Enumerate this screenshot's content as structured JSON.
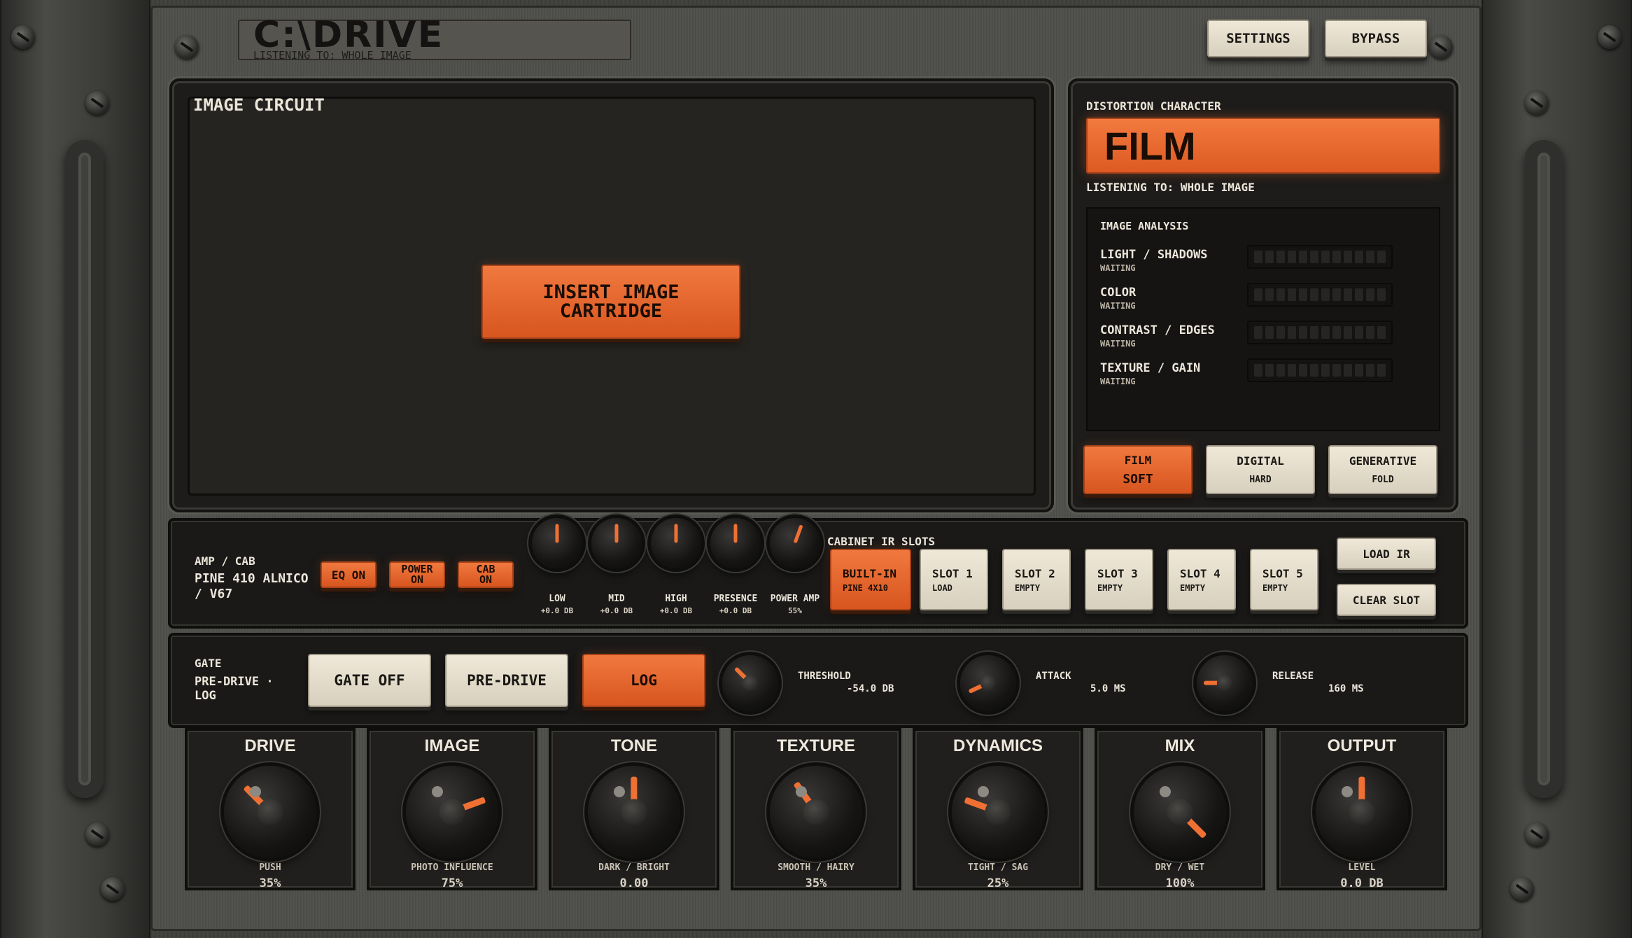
{
  "header": {
    "logo": "C:\\DRIVE",
    "listening": "LISTENING TO: WHOLE IMAGE",
    "settings_label": "SETTINGS",
    "bypass_label": "BYPASS"
  },
  "image_circuit": {
    "title": "IMAGE CIRCUIT",
    "insert_label_1": "INSERT IMAGE",
    "insert_label_2": "CARTRIDGE"
  },
  "distortion": {
    "title": "DISTORTION CHARACTER",
    "current": "FILM",
    "listening": "LISTENING TO: WHOLE IMAGE",
    "analysis_title": "IMAGE ANALYSIS",
    "analysis": [
      {
        "name": "LIGHT / SHADOWS",
        "status": "WAITING"
      },
      {
        "name": "COLOR",
        "status": "WAITING"
      },
      {
        "name": "CONTRAST / EDGES",
        "status": "WAITING"
      },
      {
        "name": "TEXTURE / GAIN",
        "status": "WAITING"
      }
    ],
    "modes": [
      {
        "name": "FILM",
        "sub": "SOFT",
        "active": true
      },
      {
        "name": "DIGITAL",
        "sub": "HARD",
        "active": false
      },
      {
        "name": "GENERATIVE",
        "sub": "FOLD",
        "active": false
      }
    ]
  },
  "amp": {
    "title": "AMP / CAB",
    "model_1": "PINE 410 ALNICO",
    "model_2": "/ V67",
    "eq_label": "EQ ON",
    "power_label_1": "POWER",
    "power_label_2": "ON",
    "cab_label_1": "CAB",
    "cab_label_2": "ON",
    "knobs": [
      {
        "name": "LOW",
        "value": "+0.0 DB"
      },
      {
        "name": "MID",
        "value": "+0.0 DB"
      },
      {
        "name": "HIGH",
        "value": "+0.0 DB"
      },
      {
        "name": "PRESENCE",
        "value": "+0.0 DB"
      },
      {
        "name": "POWER AMP",
        "value": "55%"
      }
    ]
  },
  "cabinet": {
    "title": "CABINET IR SLOTS",
    "slots": [
      {
        "name": "BUILT-IN",
        "sub": "PINE 4X10",
        "active": true
      },
      {
        "name": "SLOT 1",
        "sub": "LOAD",
        "active": false
      },
      {
        "name": "SLOT 2",
        "sub": "EMPTY",
        "active": false
      },
      {
        "name": "SLOT 3",
        "sub": "EMPTY",
        "active": false
      },
      {
        "name": "SLOT 4",
        "sub": "EMPTY",
        "active": false
      },
      {
        "name": "SLOT 5",
        "sub": "EMPTY",
        "active": false
      }
    ],
    "load_label": "LOAD IR",
    "clear_label": "CLEAR SLOT"
  },
  "gate": {
    "title": "GATE",
    "mode_1": "PRE-DRIVE ·",
    "mode_2": "LOG",
    "gate_off_label": "GATE OFF",
    "pre_drive_label": "PRE-DRIVE",
    "log_label": "LOG",
    "threshold": {
      "name": "THRESHOLD",
      "value": "-54.0 DB"
    },
    "attack": {
      "name": "ATTACK",
      "value": "5.0 MS"
    },
    "release": {
      "name": "RELEASE",
      "value": "160 MS"
    }
  },
  "main_knobs": [
    {
      "title": "DRIVE",
      "sub": "PUSH",
      "value": "35%"
    },
    {
      "title": "IMAGE",
      "sub": "PHOTO INFLUENCE",
      "value": "75%"
    },
    {
      "title": "TONE",
      "sub": "DARK / BRIGHT",
      "value": "0.00"
    },
    {
      "title": "TEXTURE",
      "sub": "SMOOTH / HAIRY",
      "value": "35%"
    },
    {
      "title": "DYNAMICS",
      "sub": "TIGHT / SAG",
      "value": "25%"
    },
    {
      "title": "MIX",
      "sub": "DRY / WET",
      "value": "100%"
    },
    {
      "title": "OUTPUT",
      "sub": "LEVEL",
      "value": "0.0 DB"
    }
  ],
  "colors": {
    "accent": "#e8642b",
    "cream": "#e6dfcf",
    "panel": "#1d1c1a"
  }
}
